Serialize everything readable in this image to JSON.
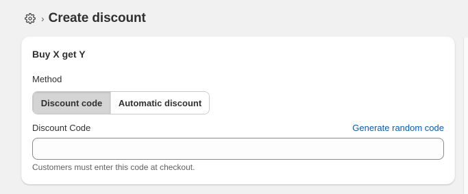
{
  "header": {
    "breadcrumb_separator": "›",
    "title": "Create discount",
    "settings_icon": "gear-icon"
  },
  "card": {
    "title": "Buy X get Y",
    "method": {
      "label": "Method",
      "options": [
        "Discount code",
        "Automatic discount"
      ],
      "selected": "Discount code"
    },
    "code": {
      "label": "Discount Code",
      "generate_link": "Generate random code",
      "value": "",
      "placeholder": "",
      "help": "Customers must enter this code at checkout."
    }
  },
  "colors": {
    "background": "#f1f1f1",
    "card": "#ffffff",
    "link": "#005bd3",
    "selected_segment": "#d4d4d4",
    "text": "#303030",
    "muted": "#616161"
  }
}
